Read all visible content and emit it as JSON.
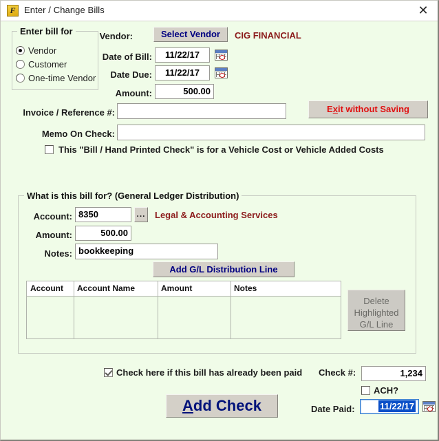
{
  "window": {
    "title": "Enter / Change Bills",
    "icon": "app-icon",
    "icon_glyph": "F",
    "close_glyph": "✕",
    "background_color": "#f0fce8",
    "accent_color": "#8b1a1a",
    "button_text_color": "#000080"
  },
  "bill_for_group": {
    "title": "Enter bill for",
    "options": [
      {
        "label": "Vendor",
        "selected": true
      },
      {
        "label": "Customer",
        "selected": false
      },
      {
        "label": "One-time Vendor",
        "selected": false
      }
    ]
  },
  "header_fields": {
    "vendor_label": "Vendor:",
    "select_vendor_button": "Select Vendor",
    "vendor_name": "CIG FINANCIAL",
    "date_of_bill_label": "Date of Bill:",
    "date_of_bill_value": "11/22/17",
    "date_due_label": "Date Due:",
    "date_due_value": "11/22/17",
    "amount_label": "Amount:",
    "amount_value": "500.00",
    "calendar_icon": "calendar-icon"
  },
  "invoice": {
    "label": "Invoice / Reference #:",
    "value": "",
    "placeholder": ""
  },
  "memo": {
    "label": "Memo On Check:",
    "value": "",
    "placeholder": ""
  },
  "vehicle_checkbox": {
    "label": "This \"Bill / Hand Printed Check\" is for a Vehicle Cost or Vehicle Added Costs",
    "checked": false
  },
  "exit_button": {
    "label_before": "E",
    "label_accel": "x",
    "label_after": "it without Saving",
    "full_label": "Exit without Saving",
    "color": "#e01010"
  },
  "gl_group": {
    "title": "What is this bill for? (General Ledger Distribution)",
    "account_label": "Account:",
    "account_value": "8350",
    "browse_button": "...",
    "account_name": "Legal & Accounting Services",
    "amount_label": "Amount:",
    "amount_value": "500.00",
    "notes_label": "Notes:",
    "notes_value": "bookkeeping",
    "add_line_button": "Add G/L Distribution Line",
    "table": {
      "columns": [
        "Account",
        "Account Name",
        "Amount",
        "Notes"
      ],
      "rows": []
    },
    "delete_button": {
      "line1": "Delete",
      "line2": "Highlighted",
      "line3": "G/L Line",
      "disabled": true
    }
  },
  "footer": {
    "already_paid_label": "Check here if this bill has already been paid",
    "already_paid_checked": true,
    "check_number_label": "Check #:",
    "check_number_value": "1,234",
    "ach_label": "ACH?",
    "ach_checked": false,
    "add_check_button_before": "A",
    "add_check_button_accel": "A",
    "add_check_button_after": "dd Check",
    "add_check_full_label": "Add Check",
    "date_paid_label": "Date Paid:",
    "date_paid_value": "11/22/17",
    "date_paid_selected": true,
    "calendar_icon": "calendar-icon"
  }
}
